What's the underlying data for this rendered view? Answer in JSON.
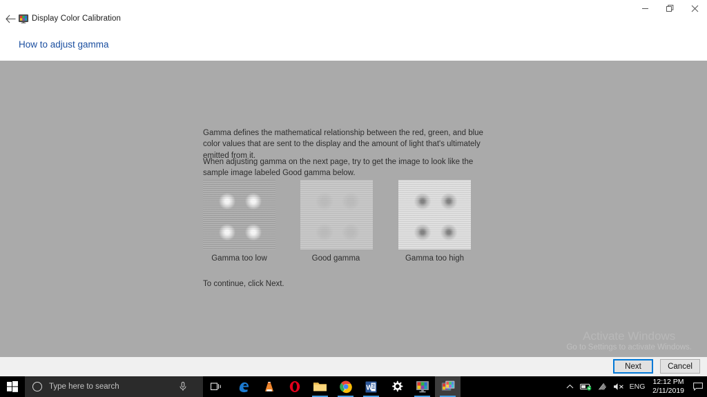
{
  "window": {
    "title": "Display Color Calibration",
    "app_icon": "monitor-color-icon",
    "back_label": "←",
    "controls": {
      "minimize": "minimize-icon",
      "restore": "restore-icon",
      "close": "close-icon"
    }
  },
  "header": {
    "help_link": "How to adjust gamma"
  },
  "content": {
    "paragraph1": "Gamma defines the mathematical relationship between the red, green, and blue color values that are sent to the display and the amount of light that's ultimately emitted from it.",
    "paragraph2": "When adjusting gamma on the next page, try to get the image to look like the sample image labeled Good gamma below.",
    "paragraph3": "To continue, click Next.",
    "samples": [
      {
        "label": "Gamma too low",
        "kind": "low"
      },
      {
        "label": "Good gamma",
        "kind": "good"
      },
      {
        "label": "Gamma too high",
        "kind": "high"
      }
    ],
    "background_color": "#aaaaaa"
  },
  "watermark": {
    "title": "Activate Windows",
    "subtitle": "Go to Settings to activate Windows."
  },
  "footer": {
    "next_label": "Next",
    "cancel_label": "Cancel",
    "focus_color": "#0078d7"
  },
  "taskbar": {
    "start_icon": "windows-start-icon",
    "search_placeholder": "Type here to search",
    "search_icon": "search-circle-icon",
    "mic_icon": "microphone-icon",
    "taskview_icon": "task-view-icon",
    "apps": [
      {
        "name": "microsoft-edge",
        "label": "e",
        "running": false
      },
      {
        "name": "vlc-media-player",
        "label": "",
        "running": false
      },
      {
        "name": "opera-browser",
        "label": "O",
        "running": false
      },
      {
        "name": "file-explorer",
        "label": "",
        "running": true
      },
      {
        "name": "google-chrome",
        "label": "",
        "running": true
      },
      {
        "name": "microsoft-word",
        "label": "W",
        "running": true
      },
      {
        "name": "settings",
        "label": "",
        "running": false
      },
      {
        "name": "display-color-calibration",
        "label": "",
        "running": true
      },
      {
        "name": "active-window",
        "label": "",
        "running": true
      }
    ],
    "tray": {
      "chevron": "show-hidden-icons-chevron",
      "battery": "battery-charging-icon",
      "network": "wifi-icon",
      "volume": "volume-muted-icon",
      "language": "ENG",
      "time": "12:12 PM",
      "date": "2/11/2019",
      "notifications": "action-center-icon"
    }
  }
}
